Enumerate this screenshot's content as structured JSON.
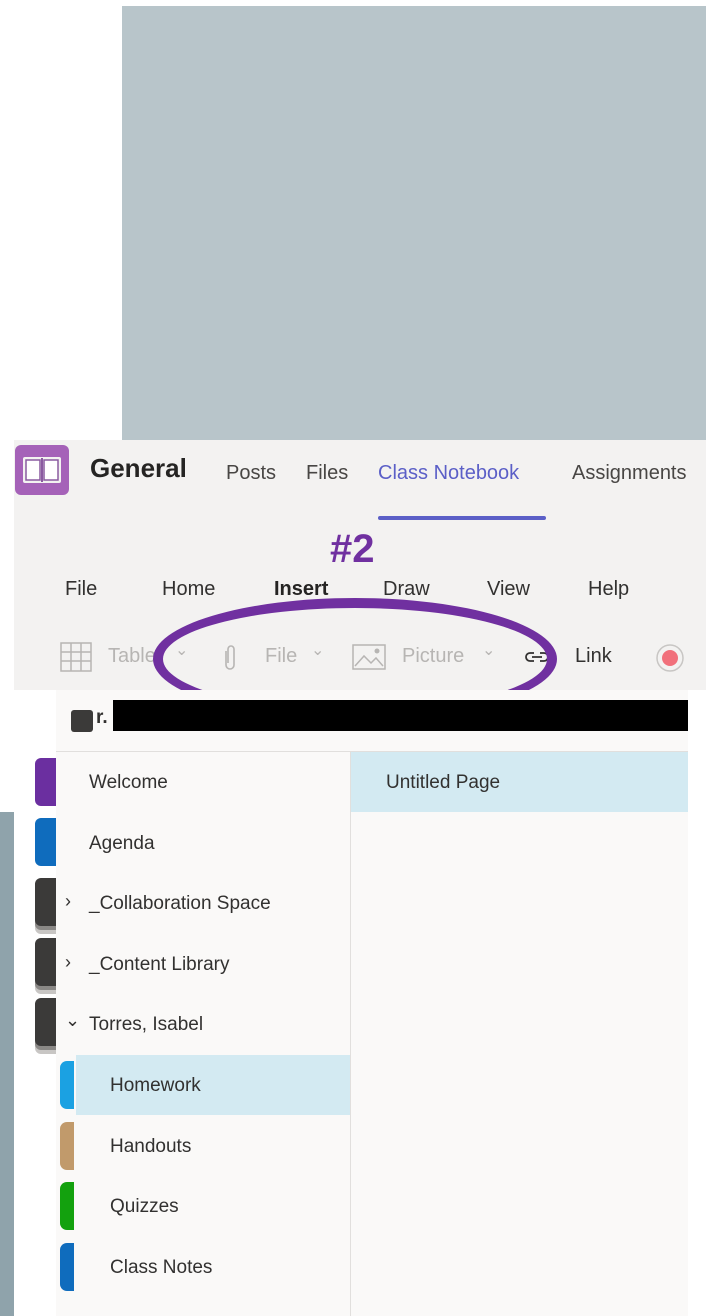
{
  "header": {
    "team_name": "General",
    "tabs": [
      {
        "label": "Posts"
      },
      {
        "label": "Files"
      },
      {
        "label": "Class Notebook"
      },
      {
        "label": "Assignments"
      }
    ],
    "active_tab": "Class Notebook"
  },
  "annotation": {
    "label": "#2"
  },
  "ribbon": {
    "menu": [
      "File",
      "Home",
      "Insert",
      "Draw",
      "View",
      "Help"
    ],
    "active_menu": "Insert",
    "tools": {
      "table": "Table",
      "file": "File",
      "picture": "Picture",
      "link": "Link"
    }
  },
  "notebook": {
    "name_visible_prefix": "r."
  },
  "sections": [
    {
      "label": "Welcome"
    },
    {
      "label": "Agenda"
    },
    {
      "label": "_Collaboration Space"
    },
    {
      "label": "_Content Library"
    },
    {
      "label": "Torres, Isabel"
    },
    {
      "label": "Homework"
    },
    {
      "label": "Handouts"
    },
    {
      "label": "Quizzes"
    },
    {
      "label": "Class Notes"
    }
  ],
  "pages": [
    {
      "label": "Untitled Page"
    }
  ],
  "colors": {
    "accent": "#5b5fc7",
    "annotation": "#7030a0",
    "selected": "#d3eaf2"
  }
}
